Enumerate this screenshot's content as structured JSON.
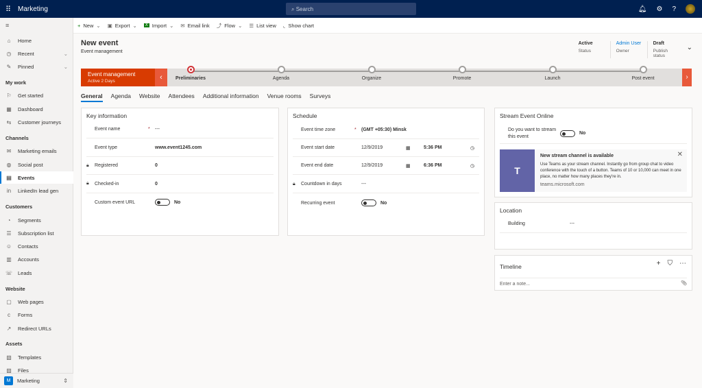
{
  "topbar": {
    "app": "Marketing",
    "search_placeholder": "Search"
  },
  "sidebar": {
    "items": [
      {
        "label": "Home",
        "icon": "⌂"
      },
      {
        "label": "Recent",
        "icon": "◷"
      },
      {
        "label": "Pinned",
        "icon": "✎"
      }
    ],
    "sections": [
      {
        "title": "My work",
        "items": [
          {
            "label": "Get started",
            "icon": "⚐"
          },
          {
            "label": "Dashboard",
            "icon": "▦"
          },
          {
            "label": "Customer journeys",
            "icon": "⇆"
          }
        ]
      },
      {
        "title": "Channels",
        "items": [
          {
            "label": "Marketing emails",
            "icon": "✉"
          },
          {
            "label": "Social post",
            "icon": "◍"
          },
          {
            "label": "Events",
            "icon": "▤"
          },
          {
            "label": "LinkedIn lead gen",
            "icon": "in"
          }
        ]
      },
      {
        "title": "Customers",
        "items": [
          {
            "label": "Segments",
            "icon": "◔"
          },
          {
            "label": "Subscription list",
            "icon": "☰"
          },
          {
            "label": "Contacts",
            "icon": "☺"
          },
          {
            "label": "Accounts",
            "icon": "▥"
          },
          {
            "label": "Leads",
            "icon": "☏"
          }
        ]
      },
      {
        "title": "Website",
        "items": [
          {
            "label": "Web pages",
            "icon": "▢"
          },
          {
            "label": "Forms",
            "icon": "c"
          },
          {
            "label": "Redirect URLs",
            "icon": "↗"
          }
        ]
      },
      {
        "title": "Assets",
        "items": [
          {
            "label": "Templates",
            "icon": "▧"
          },
          {
            "label": "Files",
            "icon": "▨"
          }
        ]
      }
    ],
    "area": {
      "badge": "M",
      "label": "Marketing"
    }
  },
  "commands": [
    {
      "label": "New",
      "icon": "+"
    },
    {
      "label": "Export",
      "icon": "▣"
    },
    {
      "label": "Import",
      "icon": "X"
    },
    {
      "label": "Email link",
      "icon": "✉"
    },
    {
      "label": "Flow",
      "icon": "⤴"
    },
    {
      "label": "List view",
      "icon": "☰"
    },
    {
      "label": "Show chart",
      "icon": "⌞"
    }
  ],
  "record": {
    "title": "New event",
    "subtitle": "Event management",
    "fields": [
      {
        "value": "Active",
        "label": "Status"
      },
      {
        "value": "Admin User",
        "label": "Owner"
      },
      {
        "value": "Draft",
        "label": "Publish status"
      }
    ]
  },
  "bpf": {
    "stage": "Event management",
    "duration": "Active 2 Days",
    "steps": [
      "Preliminaries",
      "Agenda",
      "Organize",
      "Promote",
      "Launch",
      "Post event"
    ],
    "current": 0
  },
  "tabs": [
    "General",
    "Agenda",
    "Website",
    "Attendees",
    "Additional information",
    "Venue rooms",
    "Surveys"
  ],
  "key_info": {
    "title": "Key information",
    "rows": [
      {
        "label": "Event name",
        "value": "---",
        "required": "*"
      },
      {
        "label": "Event type",
        "value": "www.event1245.com"
      },
      {
        "label": "Registered",
        "value": "0"
      },
      {
        "label": "Checked-in",
        "value": "0"
      },
      {
        "label": "Custom event URL",
        "value": "No"
      }
    ]
  },
  "schedule": {
    "title": "Schedule",
    "timezone_label": "Event time zone",
    "timezone": "(GMT +05:30) Minsk",
    "start_label": "Event start date",
    "start_date": "12/9/2019",
    "start_time": "5:36 PM",
    "end_label": "Event end date",
    "end_date": "12/9/2019",
    "end_time": "6:36 PM",
    "countdown_label": "Countdown in days",
    "countdown": "---",
    "recurring_label": "Recurring event",
    "recurring": "No"
  },
  "stream": {
    "title": "Stream Event Online",
    "question": "Do you want to stream this event",
    "value": "No",
    "banner_title": "New stream channel is available",
    "banner_text": "Use Teams as your stream channel. Instantly go from group chat to video conference with the touch of a button. Teams of 10 or 10,000 can meet in one place, no matter how many places they're in.",
    "banner_link": "teams.microsoft.com"
  },
  "location": {
    "title": "Location",
    "building_label": "Building",
    "building": "---"
  },
  "timeline": {
    "title": "Timeline",
    "placeholder": "Enter a note..."
  }
}
